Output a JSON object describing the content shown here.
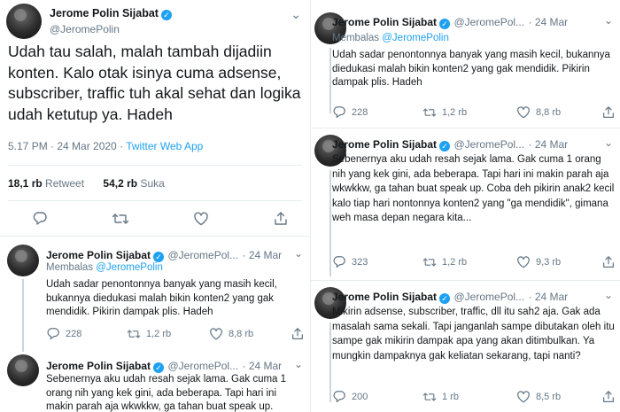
{
  "main_tweet": {
    "author_name": "Jerome Polin Sijabat",
    "handle": "@JeromePolin",
    "text": "Udah tau salah, malah tambah dijadiin konten. Kalo otak isinya cuma adsense, subscriber, traffic tuh akal sehat dan logika udah ketutup ya. Hadeh",
    "timestamp": "5.17 PM · 24 Mar 2020 · ",
    "source": "Twitter Web App",
    "retweets_count": "18,1 rb",
    "retweets_label": "Retweet",
    "likes_count": "54,2 rb",
    "likes_label": "Suka"
  },
  "left_replies": [
    {
      "author_name": "Jerome Polin Sijabat",
      "handle": "@JeromePol...",
      "date": "· 24 Mar",
      "reply_prefix": "Membalas ",
      "reply_handle": "@JeromePolin",
      "text": "Udah sadar penontonnya banyak yang masih kecil, bukannya diedukasi malah bikin konten2 yang gak mendidik. Pikirin dampak plis. Hadeh",
      "replies": "228",
      "retweets": "1,2 rb",
      "likes": "8,8 rb"
    },
    {
      "author_name": "Jerome Polin Sijabat",
      "handle": "@JeromePol...",
      "date": "· 24 Mar",
      "text": "Sebenernya aku udah resah sejak lama. Gak cuma 1 orang nih yang kek gini, ada beberapa. Tapi hari ini makin parah aja wkwkkw, ga tahan buat speak up."
    }
  ],
  "right_tweets": [
    {
      "author_name": "Jerome Polin Sijabat",
      "handle": "@JeromePol...",
      "date": "· 24 Mar",
      "reply_prefix": "Membalas ",
      "reply_handle": "@JeromePolin",
      "text": "Udah sadar penontonnya banyak yang masih kecil, bukannya diedukasi malah bikin konten2 yang gak mendidik. Pikirin dampak plis. Hadeh",
      "replies": "228",
      "retweets": "1,2 rb",
      "likes": "8,8 rb"
    },
    {
      "author_name": "Jerome Polin Sijabat",
      "handle": "@JeromePol...",
      "date": "· 24 Mar",
      "text": "Sebenernya aku udah resah sejak lama. Gak cuma 1 orang nih yang kek gini, ada beberapa. Tapi hari ini makin parah aja wkwkkw, ga tahan buat speak up. Coba deh pikirin anak2 kecil kalo tiap hari nontonnya konten2 yang \"ga mendidik\", gimana weh masa depan negara kita...",
      "replies": "323",
      "retweets": "1,2 rb",
      "likes": "9,3 rb"
    },
    {
      "author_name": "Jerome Polin Sijabat",
      "handle": "@JeromePol...",
      "date": "· 24 Mar",
      "text": "Mikirin adsense, subscriber, traffic, dll itu sah2 aja. Gak ada masalah sama sekali. Tapi janganlah sampe dibutakan oleh itu sampe gak mikirin dampak apa yang akan ditimbulkan. Ya mungkin dampaknya gak keliatan sekarang, tapi nanti?",
      "replies": "200",
      "retweets": "1 rb",
      "likes": "8,5 rb"
    }
  ],
  "colors": {
    "link": "#1da1f2",
    "secondary_text": "#657786",
    "primary_text": "#14171a",
    "divider": "#e6ecf0"
  },
  "icons": [
    "verified-badge-icon",
    "reply-icon",
    "retweet-icon",
    "like-icon",
    "share-icon"
  ]
}
